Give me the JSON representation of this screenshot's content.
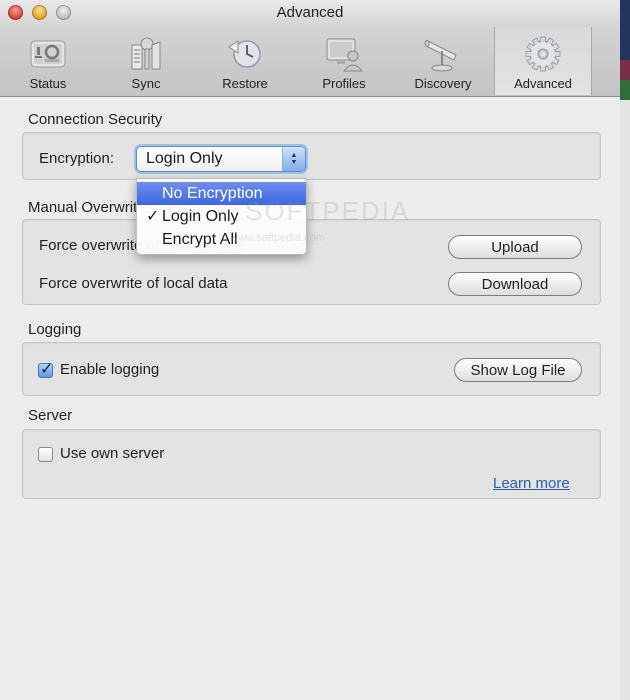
{
  "window": {
    "title": "Advanced",
    "traffic_lights": [
      "close",
      "minimize",
      "zoom"
    ]
  },
  "toolbar": {
    "tabs": [
      {
        "label": "Status",
        "icon": "status-icon",
        "active": false
      },
      {
        "label": "Sync",
        "icon": "sync-keys-icon",
        "active": false
      },
      {
        "label": "Restore",
        "icon": "restore-clock-icon",
        "active": false
      },
      {
        "label": "Profiles",
        "icon": "profiles-icon",
        "active": false
      },
      {
        "label": "Discovery",
        "icon": "telescope-icon",
        "active": false
      },
      {
        "label": "Advanced",
        "icon": "gear-icon",
        "active": true
      }
    ]
  },
  "connection_security": {
    "heading": "Connection Security",
    "encryption_label": "Encryption:",
    "encryption_value": "Login Only",
    "encryption_options": [
      {
        "label": "No Encryption",
        "highlighted": true,
        "checked": false
      },
      {
        "label": "Login Only",
        "highlighted": false,
        "checked": true
      },
      {
        "label": "Encrypt All",
        "highlighted": false,
        "checked": false
      }
    ],
    "check_glyph": "✓"
  },
  "manual_overwrite": {
    "heading": "Manual Overwrite",
    "rows": [
      {
        "label": "Force overwrite of remote data",
        "button": "Upload"
      },
      {
        "label": "Force overwrite of local data",
        "button": "Download"
      }
    ]
  },
  "logging": {
    "heading": "Logging",
    "enable_label": "Enable logging",
    "enable_checked": true,
    "show_log_button": "Show Log File"
  },
  "server": {
    "heading": "Server",
    "use_own_label": "Use own server",
    "use_own_checked": false,
    "learn_more": "Learn more"
  },
  "watermark": {
    "text": "SOFTPEDIA",
    "subtext": "www.softpedia.com"
  }
}
